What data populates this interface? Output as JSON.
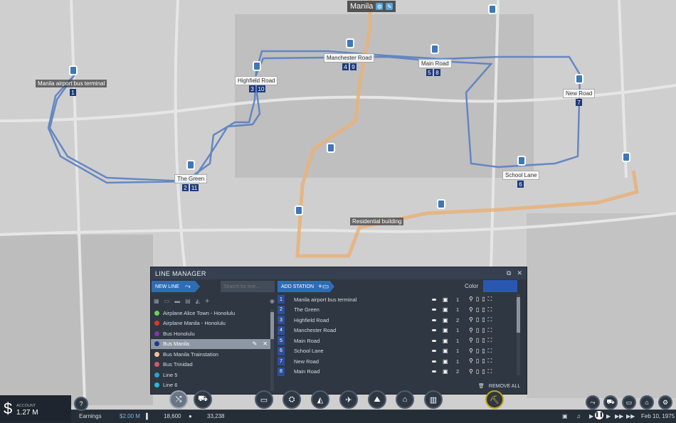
{
  "colors": {
    "accent": "#2e6db4",
    "panel": "#2f3742",
    "line_blue": "#5a7fc0",
    "road_orange": "#e8b27a",
    "line_color_swatch": "#2a58b0"
  },
  "map": {
    "city": "Manila",
    "labels": [
      {
        "key": "airport",
        "text": "Manila airport bus terminal",
        "lines": [
          "1"
        ]
      },
      {
        "key": "green",
        "text": "The Green",
        "lines": [
          "2",
          "11"
        ]
      },
      {
        "key": "highfield",
        "text": "Highfield Road",
        "lines": [
          "3",
          "10"
        ]
      },
      {
        "key": "manchester",
        "text": "Manchester Road",
        "lines": [
          "4",
          "9"
        ]
      },
      {
        "key": "main",
        "text": "Main Road",
        "lines": [
          "5",
          "8"
        ]
      },
      {
        "key": "newroad",
        "text": "New Road",
        "lines": [
          "7"
        ]
      },
      {
        "key": "school",
        "text": "School Lane",
        "lines": [
          "6"
        ]
      }
    ],
    "residential_tooltip": "Residential building"
  },
  "line_manager": {
    "title": "LINE MANAGER",
    "new_line": "NEW LINE",
    "search_placeholder": "Search for line...",
    "add_station": "ADD STATION",
    "color_label": "Color",
    "remove_all": "REMOVE ALL",
    "lines": [
      {
        "name": "Airplane Alice Town - Honolulu",
        "color": "#6fcf5a"
      },
      {
        "name": "Airplane Manila - Honolulu",
        "color": "#d63a2a"
      },
      {
        "name": "Bus Honolulu",
        "color": "#7b3aa8"
      },
      {
        "name": "Bus Manila",
        "color": "#1e3a8a",
        "selected": true
      },
      {
        "name": "Bus Manila Trainstation",
        "color": "#f0c39a"
      },
      {
        "name": "Bus Trinidad",
        "color": "#d05a6a"
      },
      {
        "name": "Line 5",
        "color": "#2f9ed8"
      },
      {
        "name": "Line 6",
        "color": "#2ab8d6"
      }
    ],
    "stations": [
      {
        "num": "1",
        "name": "Manila airport bus terminal",
        "count": "1"
      },
      {
        "num": "2",
        "name": "The Green",
        "count": "1"
      },
      {
        "num": "3",
        "name": "Highfield Road",
        "count": "2"
      },
      {
        "num": "4",
        "name": "Manchester Road",
        "count": "1"
      },
      {
        "num": "5",
        "name": "Main Road",
        "count": "1"
      },
      {
        "num": "6",
        "name": "School Lane",
        "count": "1"
      },
      {
        "num": "7",
        "name": "New Road",
        "count": "1"
      },
      {
        "num": "8",
        "name": "Main Road",
        "count": "2"
      }
    ]
  },
  "account": {
    "label": "ACCOUNT",
    "value": "1.27 M"
  },
  "status": {
    "earnings_label": "Earnings",
    "earnings_value": "$2.00 M",
    "population": "18,600",
    "passengers": "33,238",
    "date": "Feb 10, 1975"
  },
  "help": "?"
}
